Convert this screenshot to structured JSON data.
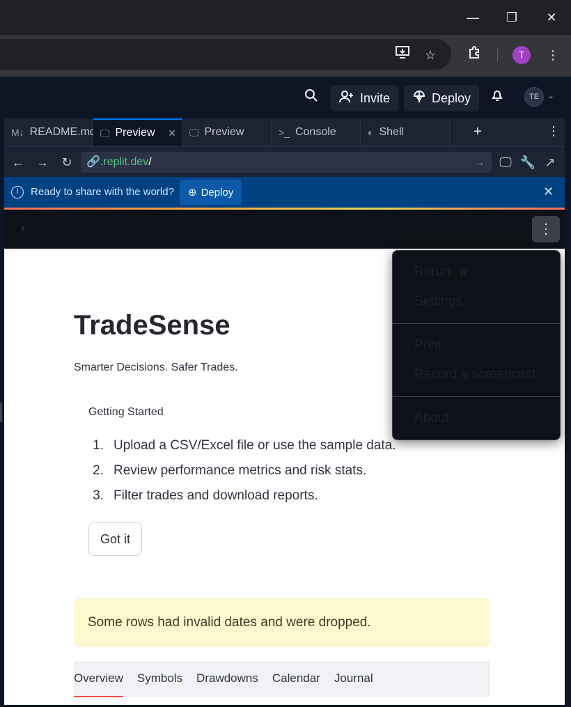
{
  "browser": {
    "minimize": "—",
    "maximize": "❐",
    "close": "✕",
    "profile_initial": "T"
  },
  "replit_header": {
    "invite_label": "Invite",
    "deploy_label": "Deploy",
    "user_initials": "TE"
  },
  "tabs": [
    {
      "label": "README.md",
      "icon": "markdown-icon"
    },
    {
      "label": "Preview",
      "icon": "monitor-icon",
      "active": true
    },
    {
      "label": "Preview",
      "icon": "monitor-icon"
    },
    {
      "label": "Console",
      "icon": "terminal-icon"
    },
    {
      "label": "Shell",
      "icon": "shell-icon"
    }
  ],
  "urlbar": {
    "domain": ".replit.dev",
    "path": "/"
  },
  "banner": {
    "message": "Ready to share with the world?",
    "deploy_label": "Deploy"
  },
  "app": {
    "title": "TradeSense",
    "subtitle": "Smarter Decisions. Safer Trades.",
    "getting_started_label": "Getting Started",
    "steps": [
      {
        "num": "1.",
        "text": "Upload a CSV/Excel file or use the sample data."
      },
      {
        "num": "2.",
        "text": "Review performance metrics and risk stats."
      },
      {
        "num": "3.",
        "text": "Filter trades and download reports."
      }
    ],
    "got_it_label": "Got it",
    "warning": "Some rows had invalid dates and were dropped.",
    "tabs": [
      "Overview",
      "Symbols",
      "Drawdowns",
      "Calendar",
      "Journal"
    ]
  },
  "main_menu": {
    "rerun": "Rerun",
    "rerun_key": "R",
    "settings": "Settings",
    "print": "Print",
    "record": "Record a screencast",
    "about": "About"
  },
  "colors": {
    "replit_bg": "#0e1525",
    "banner_bg": "#004182",
    "warning_bg": "#fdf8cd",
    "active_tab_underline": "#ff4b4b"
  }
}
